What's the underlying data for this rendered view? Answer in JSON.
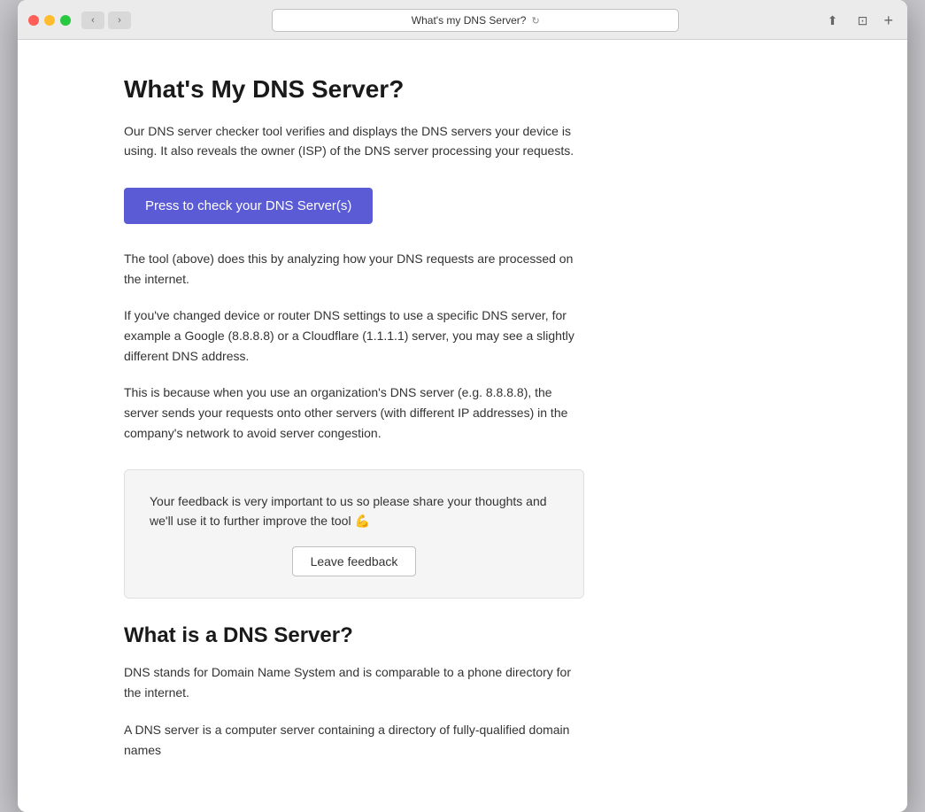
{
  "browser": {
    "address_bar_text": "What's my DNS Server?",
    "back_label": "‹",
    "forward_label": "›",
    "reload_label": "↻",
    "share_label": "⬆",
    "tab_label": "⊡",
    "add_tab_label": "+"
  },
  "page": {
    "title": "What's My DNS Server?",
    "intro": "Our DNS server checker tool verifies and displays the DNS servers your device is using. It also reveals the owner (ISP) of the DNS server processing your requests.",
    "cta_button": "Press to check your DNS Server(s)",
    "body1": "The tool (above) does this by analyzing how your DNS requests are processed on the internet.",
    "body2": "If you've changed device or router DNS settings to use a specific DNS server, for example a Google (8.8.8.8) or a Cloudflare (1.1.1.1) server, you may see a slightly different DNS address.",
    "body3": "This is because when you use an organization's DNS server (e.g. 8.8.8.8), the server sends your requests onto other servers (with different IP addresses) in the company's network to avoid server congestion.",
    "feedback_text": "Your feedback is very important to us so please share your thoughts and we'll use it to further improve the tool 💪",
    "feedback_button": "Leave feedback",
    "section2_title": "What is a DNS Server?",
    "section2_body1": "DNS stands for Domain Name System and is comparable to a phone directory for the internet.",
    "section2_body2": "A DNS server is a computer server containing a directory of fully-qualified domain names"
  }
}
